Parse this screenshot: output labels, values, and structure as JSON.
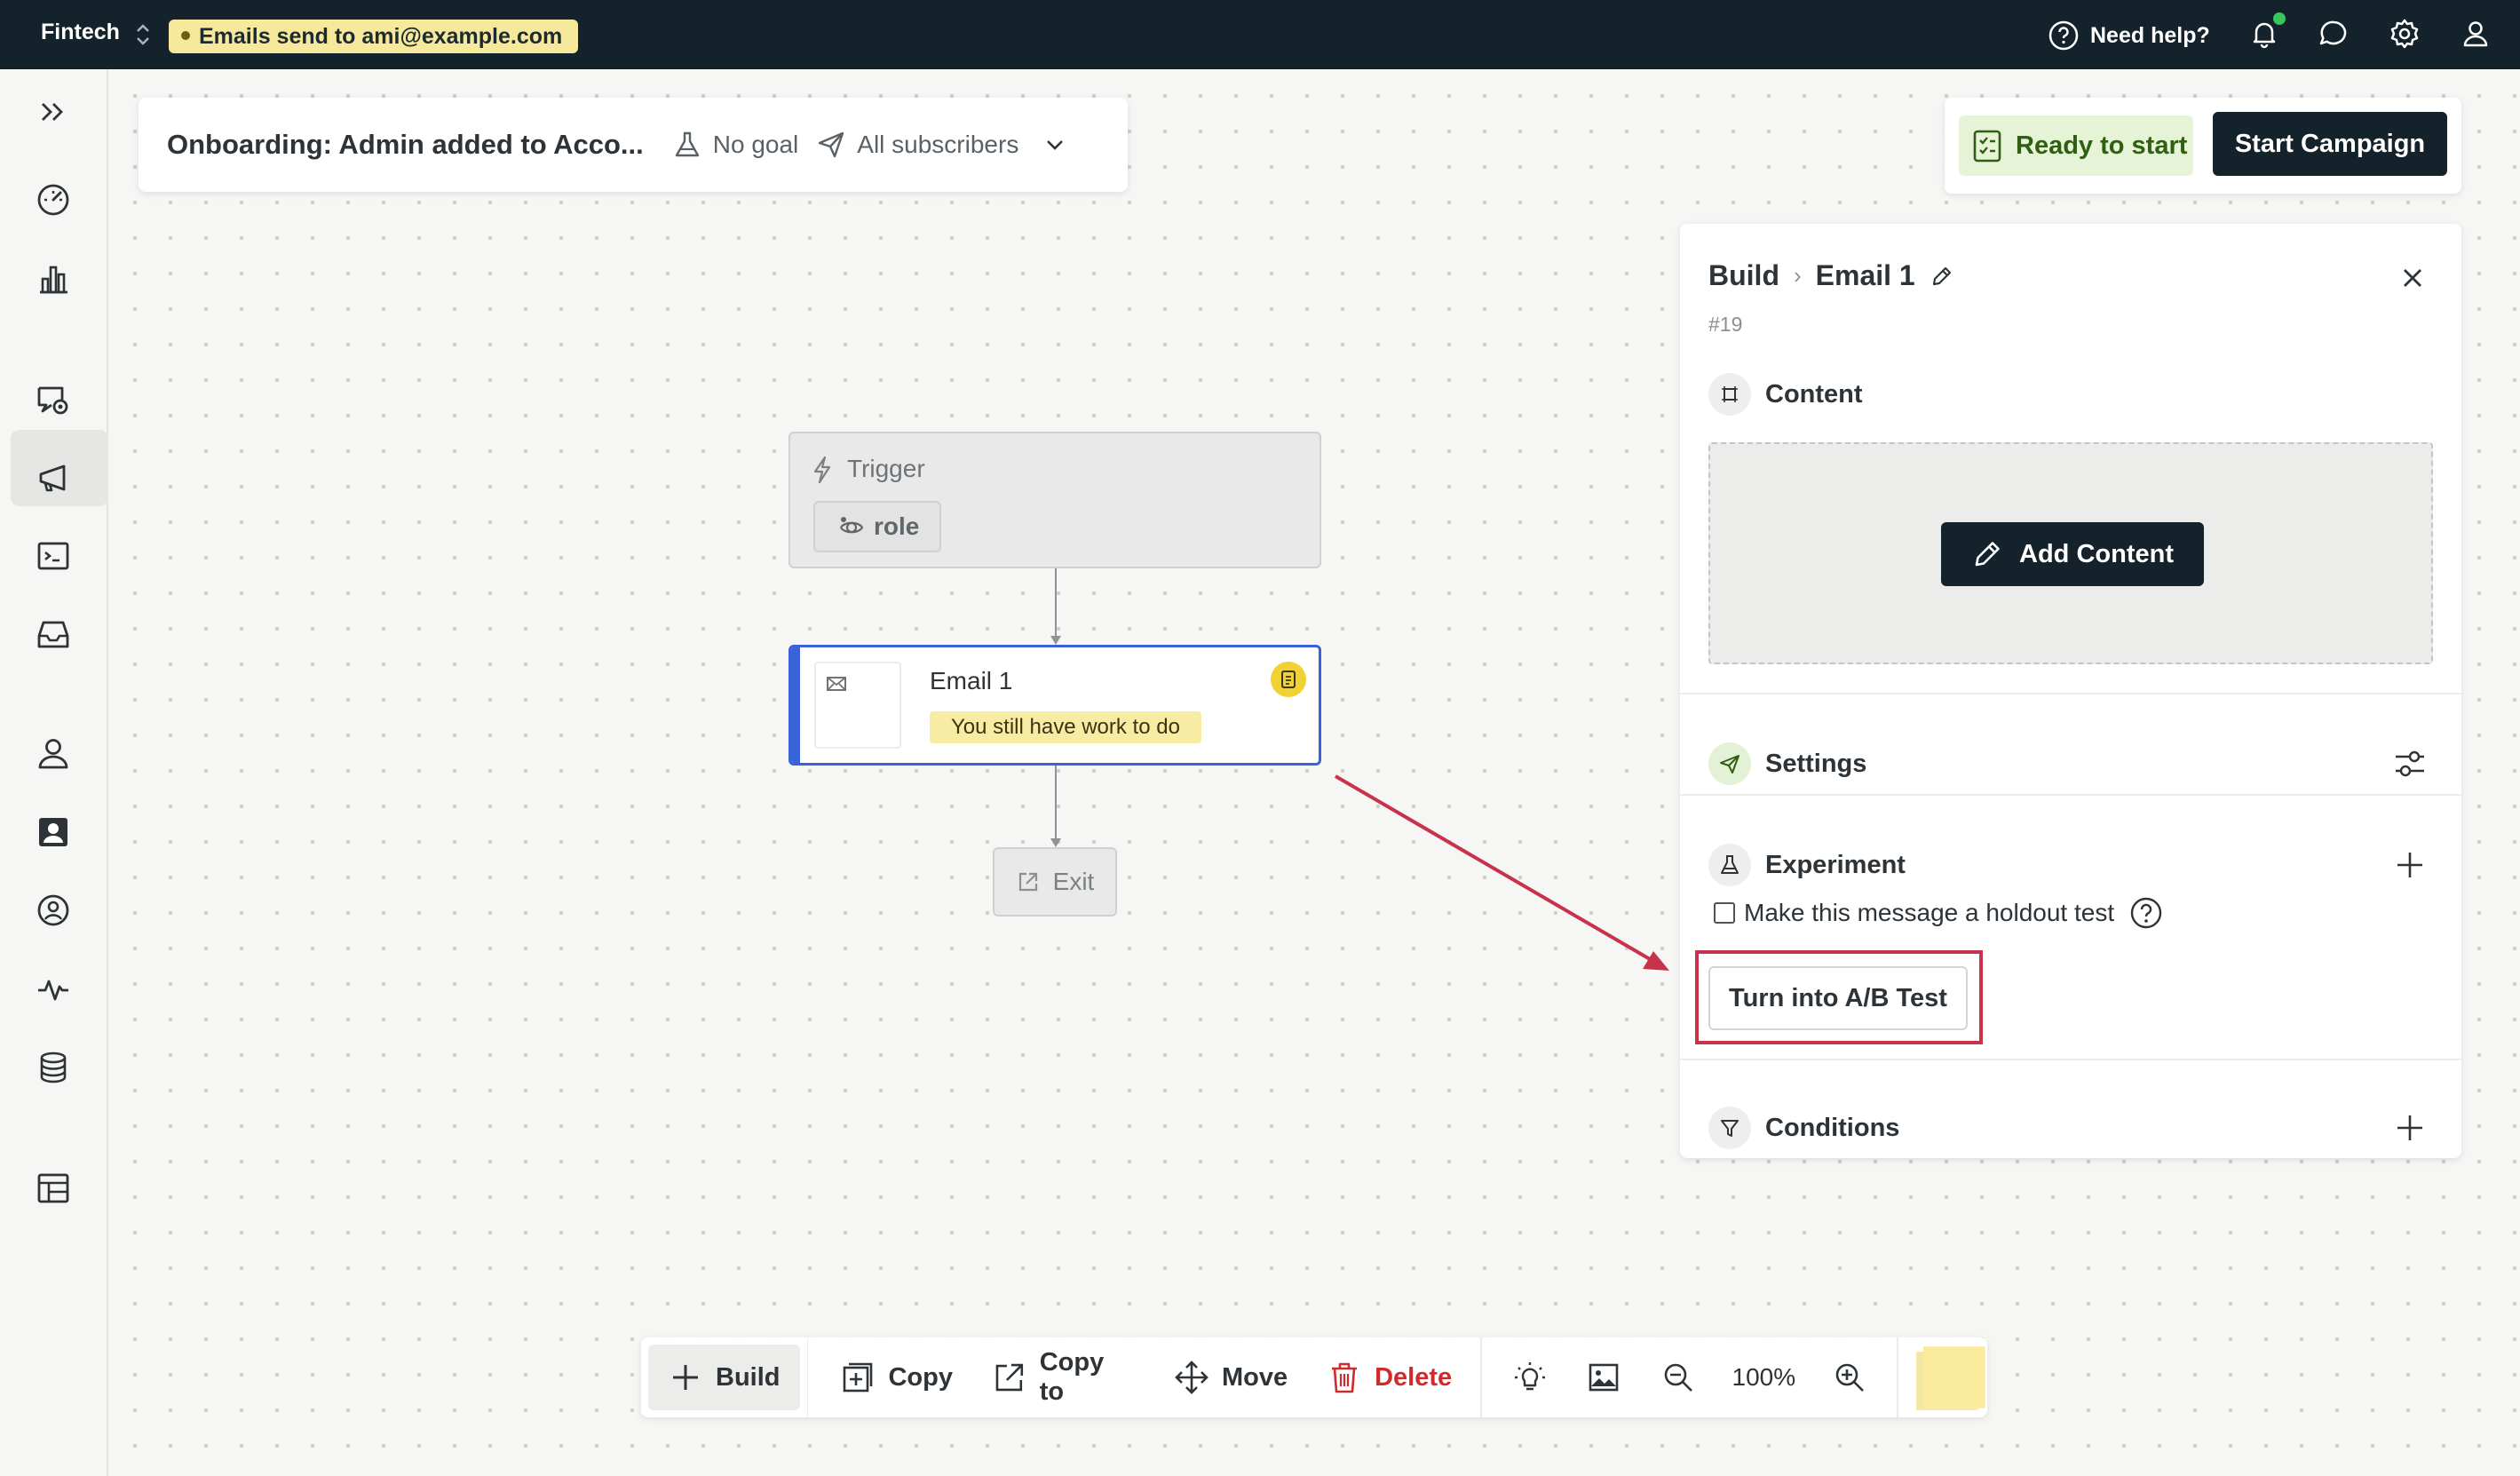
{
  "topbar": {
    "workspace": "Fintech",
    "env_badge": "Emails send to ami@example.com",
    "help": "Need help?",
    "icons": [
      "help-circle-icon",
      "bell-icon",
      "chat-icon",
      "gear-icon",
      "user-icon"
    ]
  },
  "rail": {
    "icons": [
      "expand-icon",
      "dashboard-icon",
      "analytics-icon",
      "campaigns-icon",
      "broadcast-icon",
      "transactional-icon",
      "inbox-icon",
      "person-icon",
      "contacts-icon",
      "segments-icon",
      "activity-icon",
      "data-icon",
      "objects-icon"
    ],
    "active": "campaigns-icon"
  },
  "campaign": {
    "name": "Onboarding: Admin added to Acco...",
    "goal": "No goal",
    "audience": "All subscribers"
  },
  "status": {
    "ready": "Ready to start",
    "start": "Start Campaign"
  },
  "workflow": {
    "trigger_title": "Trigger",
    "trigger_chip": "role",
    "email_title": "Email 1",
    "email_warning": "You still have work to do",
    "exit": "Exit"
  },
  "panel": {
    "crumb_root": "Build",
    "crumb_separator": "›",
    "crumb_current": "Email 1",
    "id": "#19",
    "content_title": "Content",
    "add_content": "Add Content",
    "settings_title": "Settings",
    "experiment_title": "Experiment",
    "holdout_label": "Make this message a holdout test",
    "ab_button": "Turn into A/B Test",
    "conditions_title": "Conditions"
  },
  "toolbar": {
    "build": "Build",
    "copy": "Copy",
    "copy_to": "Copy to",
    "move": "Move",
    "delete": "Delete",
    "zoom": "100%"
  },
  "colors": {
    "topbar": "#14232b",
    "selected_node": "#3b63d9",
    "annotation": "#c8324a",
    "ready_bg": "#e6f3d7",
    "warning_bg": "#f8eba3",
    "delete": "#d12a2a"
  }
}
